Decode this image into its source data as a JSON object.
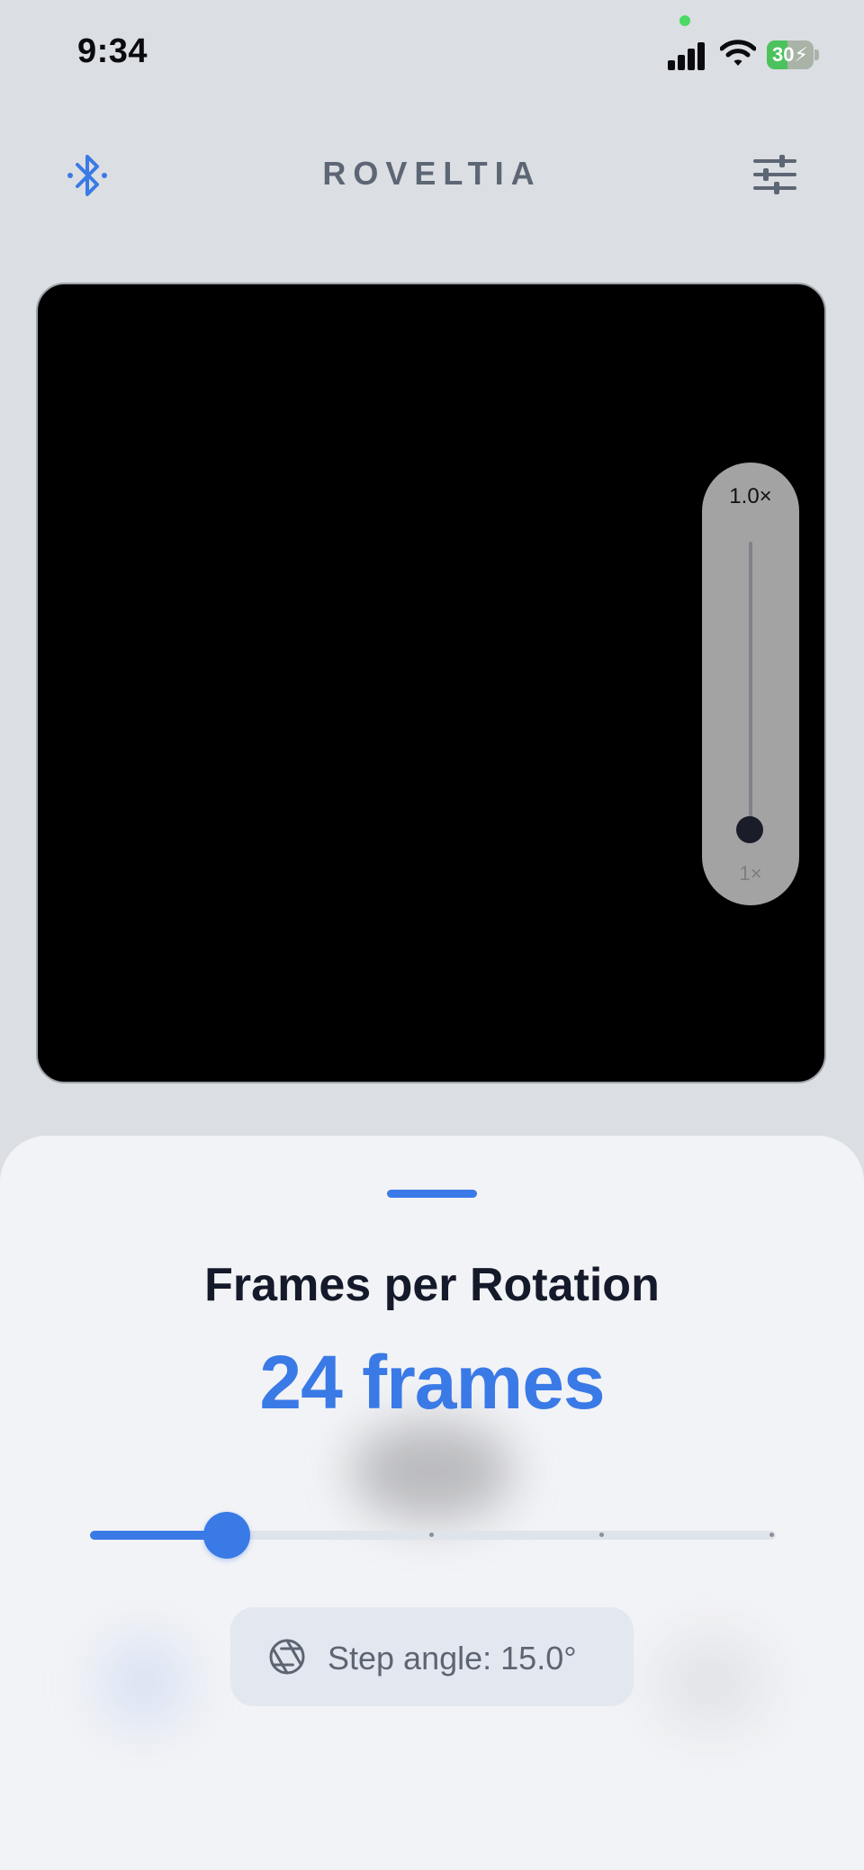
{
  "status_bar": {
    "time": "9:34",
    "battery_level": "30",
    "battery_charging": true
  },
  "header": {
    "title": "ROVELTIA",
    "left_icon": "bluetooth-icon",
    "right_icon": "sliders-settings-icon"
  },
  "camera": {
    "zoom_value": "1.0×",
    "zoom_min_label": "1×",
    "zoom_level": 0.0
  },
  "sheet": {
    "title": "Frames per Rotation",
    "value_text": "24 frames",
    "slider_fraction": 0.2,
    "step_icon": "aperture-icon",
    "step_angle_text": "Step angle: 15.0°"
  },
  "colors": {
    "accent": "#3a7ae6",
    "background": "#dbdee2",
    "sheet": "#f2f3f6",
    "title_text": "#151a2b"
  }
}
